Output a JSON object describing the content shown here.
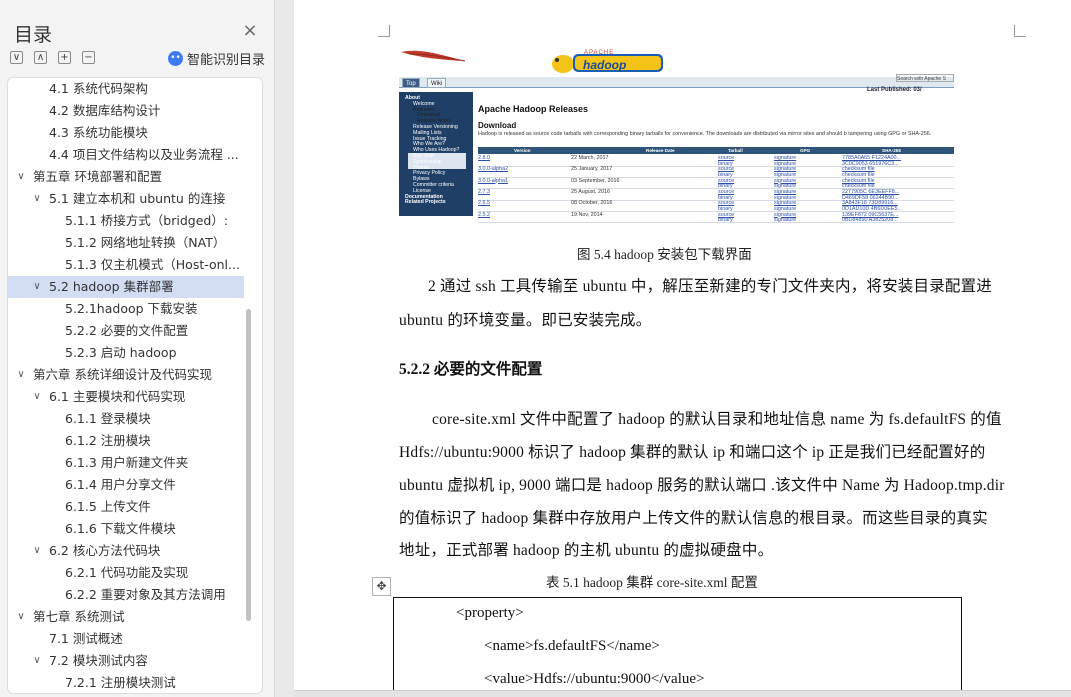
{
  "nav": {
    "title": "目录",
    "smart_label": "智能识别目录",
    "toolbar": {
      "collapse_all": "∨",
      "expand_up": "∧",
      "add": "+",
      "remove": "−"
    },
    "items": [
      {
        "label": "4.1 系统代码架构"
      },
      {
        "label": "4.2 数据库结构设计"
      },
      {
        "label": "4.3  系统功能模块"
      },
      {
        "label": "4.4  项目文件结构以及业务流程 ..."
      },
      {
        "label": "第五章  环境部署和配置",
        "arrow": "∨"
      },
      {
        "label": "5.1  建立本机和 ubuntu 的连接",
        "arrow": "∨"
      },
      {
        "label": "5.1.1  桥接方式（bridged）:"
      },
      {
        "label": "5.1.2  网络地址转换（NAT）"
      },
      {
        "label": "5.1.3  仅主机模式（Host-onl..."
      },
      {
        "label": "5.2 hadoop 集群部署",
        "arrow": "∨",
        "selected": true
      },
      {
        "label": "5.2.1hadoop 下载安装"
      },
      {
        "label": "5.2.2  必要的文件配置"
      },
      {
        "label": "5.2.3  启动 hadoop"
      },
      {
        "label": "第六章  系统详细设计及代码实现",
        "arrow": "∨"
      },
      {
        "label": "6.1 主要模块和代码实现",
        "arrow": "∨"
      },
      {
        "label": "6.1.1  登录模块"
      },
      {
        "label": "6.1.2 注册模块"
      },
      {
        "label": "6.1.3 用户新建文件夹"
      },
      {
        "label": "6.1.4 用户分享文件"
      },
      {
        "label": "6.1.5 上传文件"
      },
      {
        "label": "6.1.6 下载文件模块"
      },
      {
        "label": "6.2 核心方法代码块",
        "arrow": "∨"
      },
      {
        "label": "6.2.1  代码功能及实现"
      },
      {
        "label": "6.2.2  重要对象及其方法调用"
      },
      {
        "label": "第七章  系统测试",
        "arrow": "∨"
      },
      {
        "label": "7.1  测试概述"
      },
      {
        "label": "7.2 模块测试内容",
        "arrow": "∨"
      },
      {
        "label": "7.2.1  注册模块测试"
      }
    ]
  },
  "screenshot": {
    "logo_text": "hadoop",
    "logo_small": "APACHE",
    "tabs": [
      "Top",
      "Wiki"
    ],
    "search": "Search with Apache S",
    "published": "Last Published: 03/",
    "sidebar": [
      {
        "label": "About",
        "kind": "hdr"
      },
      {
        "label": "Welcome"
      },
      {
        "label": "Releases",
        "kind": "light"
      },
      {
        "label": "Download",
        "kind": "light"
      },
      {
        "label": "Release Notes",
        "kind": "light"
      },
      {
        "label": "Release Versioning"
      },
      {
        "label": "Mailing Lists"
      },
      {
        "label": "Issue Tracking"
      },
      {
        "label": "Who We Are?"
      },
      {
        "label": "Who Uses Hadoop?"
      },
      {
        "label": "Buy Stuff"
      },
      {
        "label": "Sponsorship"
      },
      {
        "label": "Thanks"
      },
      {
        "label": "Privacy Policy"
      },
      {
        "label": "Bylaws"
      },
      {
        "label": "Committer criteria"
      },
      {
        "label": "License"
      },
      {
        "label": "Documentation",
        "kind": "hdr"
      },
      {
        "label": "Related Projects",
        "kind": "hdr"
      }
    ],
    "heading": "Apache Hadoop Releases",
    "subheading": "Download",
    "intro": "Hadoop is released as source code tarballs with corresponding binary tarballs for convenience. The downloads are distributed via mirror sites and should b tampering using GPG or SHA-256.",
    "columns": [
      "Version",
      "Release Date",
      "Tarball",
      "GPG",
      "SHA-256"
    ],
    "rows": [
      {
        "version": "2.8.0",
        "date": "22 March, 2017",
        "tarball": [
          "source",
          "binary"
        ],
        "gpg": [
          "signature",
          "signature"
        ],
        "sha": [
          "7785A0A65 F1224A00...",
          "3C0C9053 651976C3..."
        ]
      },
      {
        "version": "3.0.0-alpha2",
        "date": "25 January, 2017",
        "tarball": [
          "source",
          "binary"
        ],
        "gpg": [
          "signature",
          "signature"
        ],
        "sha": [
          "checksum file",
          "checksum file"
        ]
      },
      {
        "version": "3.0.0-alpha1",
        "date": "03 September, 2016",
        "tarball": [
          "source",
          "binary"
        ],
        "gpg": [
          "signature",
          "signature"
        ],
        "sha": [
          "checksum file",
          "checksum file"
        ]
      },
      {
        "version": "2.7.3",
        "date": "25 August, 2016",
        "tarball": [
          "source",
          "binary"
        ],
        "gpg": [
          "signature",
          "signature"
        ],
        "sha": [
          "2277905C 6E3EEFF8...",
          "D469DF58 06244B90..."
        ]
      },
      {
        "version": "2.6.5",
        "date": "08 October, 2016",
        "tarball": [
          "source",
          "binary"
        ],
        "gpg": [
          "signature",
          "signature"
        ],
        "sha": [
          "3A843F18 73D89916...",
          "0D1AD10D 4B6D0EE5..."
        ]
      },
      {
        "version": "2.5.2",
        "date": "19 Nov, 2014",
        "tarball": [
          "source",
          "binary"
        ],
        "gpg": [
          "signature",
          "signature"
        ],
        "sha": [
          "139EF872 09C5637E...",
          "0BD84890 A3825208..."
        ]
      }
    ]
  },
  "document": {
    "figure_caption": "图 5.4 hadoop 安装包下载界面",
    "para1_line1": "2 通过 ssh 工具传输至 ubuntu 中，解压至新建的专门文件夹内，将安装目录配置进",
    "para1_line2": "ubuntu 的环境变量。即已安装完成。",
    "section_heading": "5.2.2  必要的文件配置",
    "para2_lines": [
      "core-site.xml 文件中配置了 hadoop 的默认目录和地址信息 name 为 fs.defaultFS 的值",
      "Hdfs://ubuntu:9000 标识了 hadoop 集群的默认 ip 和端口这个 ip 正是我们已经配置好的",
      "ubuntu 虚拟机 ip, 9000 端口是 hadoop 服务的默认端口 .该文件中 Name 为 Hadoop.tmp.dir",
      "的值标识了 hadoop 集群中存放用户上传文件的默认信息的根目录。而这些目录的真实",
      "地址，正式部署 hadoop 的主机 ubuntu 的虚拟硬盘中。"
    ],
    "table_caption": "表 5.1 hadoop 集群 core-site.xml 配置",
    "code_lines": [
      "<property>",
      "<name>fs.defaultFS</name>",
      "<value>Hdfs://ubuntu:9000</value>"
    ]
  }
}
